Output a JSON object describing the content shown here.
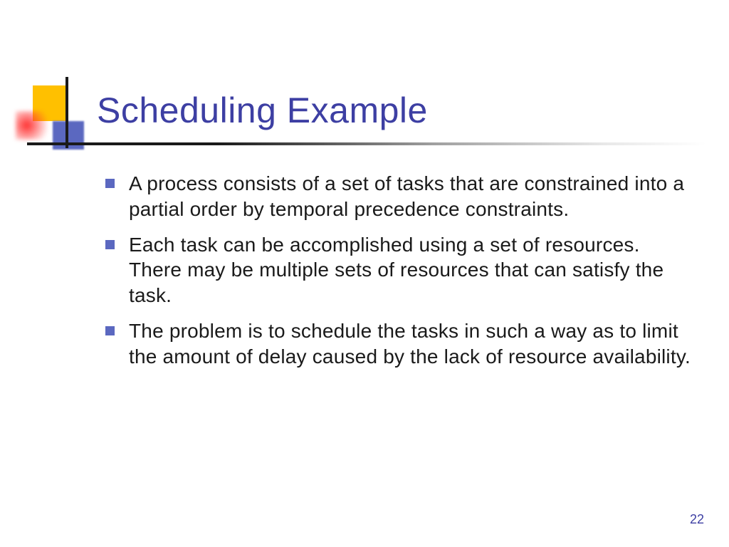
{
  "slide": {
    "title": "Scheduling Example",
    "bullets": [
      "A process consists of a set of tasks that are constrained into a partial order by temporal precedence constraints.",
      "Each task can be accomplished using a set of resources.  There may be multiple sets of resources that can satisfy the task.",
      "The problem is to schedule the tasks in such a way as to limit the amount of delay caused by the lack of resource availability."
    ],
    "page_number": "22"
  }
}
